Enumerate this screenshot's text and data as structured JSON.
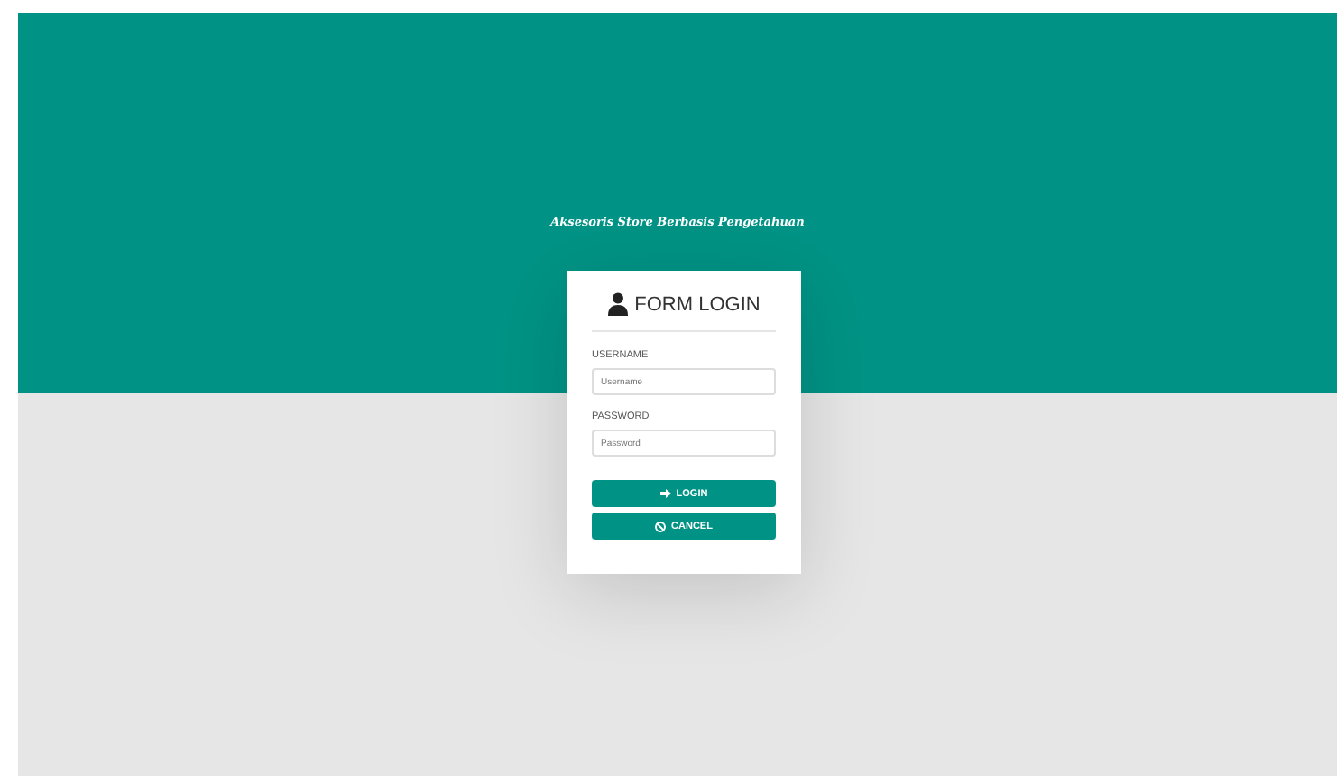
{
  "site_title": "Aksesoris Store Berbasis Pengetahuan",
  "login": {
    "title": "FORM LOGIN",
    "fields": [
      {
        "label": "USERNAME",
        "placeholder": "Username"
      },
      {
        "label": "PASSWORD",
        "placeholder": "Password"
      }
    ],
    "buttons": [
      {
        "label": "LOGIN",
        "kind": "login"
      },
      {
        "label": "CANCEL",
        "kind": "cancel"
      }
    ]
  }
}
